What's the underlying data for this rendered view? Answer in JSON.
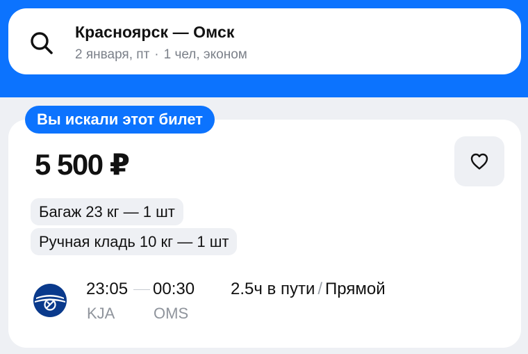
{
  "search": {
    "route": "Красноярск — Омск",
    "date": "2 января, пт",
    "separator": "·",
    "passengers": "1 чел, эконом"
  },
  "ticket": {
    "badge": "Вы искали этот билет",
    "price": "5 500 ₽",
    "baggage": "Багаж 23 кг — 1 шт",
    "hand_luggage": "Ручная кладь 10 кг — 1 шт",
    "departure_time": "23:05",
    "arrival_time": "00:30",
    "departure_code": "KJA",
    "arrival_code": "OMS",
    "duration": "2.5ч в пути",
    "duration_separator": "/",
    "flight_type": "Прямой"
  },
  "icons": {
    "search": "search-icon",
    "favorite": "heart-icon",
    "airline": "airline-logo"
  },
  "colors": {
    "brand_blue": "#0c73fe",
    "background": "#eef0f4",
    "airline_logo": "#0a3a8c"
  }
}
